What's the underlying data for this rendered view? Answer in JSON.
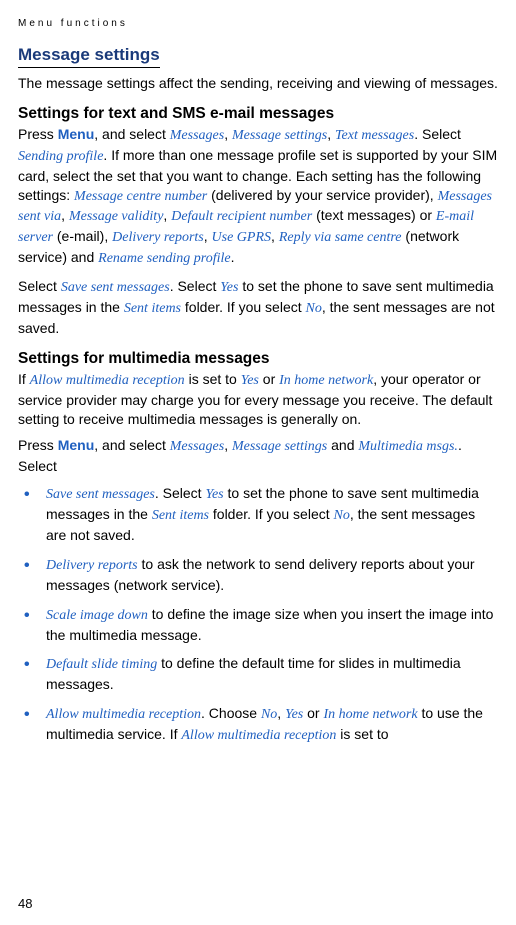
{
  "header_label": "Menu functions",
  "page_number": "48",
  "title": "Message settings",
  "intro": "The message settings affect the sending, receiving and viewing of messages.",
  "sms": {
    "heading": "Settings for text and SMS e-mail messages",
    "p1_1": "Press ",
    "p1_menu": "Menu",
    "p1_2": ", and select ",
    "p1_messages": "Messages",
    "p1_sep1": ", ",
    "p1_msg_settings": "Message settings",
    "p1_sep2": ", ",
    "p1_text_messages": "Text messages",
    "p1_3": ". Select ",
    "p1_sending_profile": "Sending profile",
    "p1_4": ". If more than one message profile set is supported by your SIM card, select the set that you want to change. Each setting has the following settings: ",
    "p1_centre": "Message centre number",
    "p1_5": " (delivered by your service provider), ",
    "p1_sentvia": "Messages sent via",
    "p1_sep3": ", ",
    "p1_validity": "Message validity",
    "p1_sep4": ", ",
    "p1_defrecip": "Default recipient number",
    "p1_6": " (text messages) or ",
    "p1_emailserver": "E-mail server",
    "p1_7": " (e-mail), ",
    "p1_delivery": "Delivery reports",
    "p1_sep5": ", ",
    "p1_gprs": "Use GPRS",
    "p1_sep6": ", ",
    "p1_replyvia": "Reply via same centre",
    "p1_8": " (network service) and ",
    "p1_rename": "Rename sending profile",
    "p1_9": ".",
    "p2_1": "Select ",
    "p2_save": "Save sent messages",
    "p2_2": ". Select ",
    "p2_yes": "Yes",
    "p2_3": " to set the phone to save sent multimedia messages in the ",
    "p2_sent": "Sent items",
    "p2_4": " folder. If you select ",
    "p2_no": "No",
    "p2_5": ", the sent messages are not saved."
  },
  "mms": {
    "heading": "Settings for multimedia messages",
    "p1_1": "If ",
    "p1_allow": "Allow multimedia reception",
    "p1_2": " is set to ",
    "p1_yes": "Yes",
    "p1_3": " or ",
    "p1_home": "In home network",
    "p1_4": ", your operator or service provider may charge you for every message you receive. The default setting to receive multimedia messages is generally on.",
    "p2_1": "Press ",
    "p2_menu": "Menu",
    "p2_2": ", and select ",
    "p2_messages": "Messages",
    "p2_sep1": ", ",
    "p2_msg_settings": "Message settings",
    "p2_3": " and ",
    "p2_mms": "Multimedia msgs.",
    "p2_4": ". Select",
    "bullets": {
      "b1_term": "Save sent messages",
      "b1_1": ". Select ",
      "b1_yes": "Yes",
      "b1_2": " to set the phone to save sent multimedia messages in the ",
      "b1_sent": "Sent items",
      "b1_3": " folder. If you select ",
      "b1_no": "No",
      "b1_4": ", the sent messages are not saved.",
      "b2_term": "Delivery reports",
      "b2_1": " to ask the network to send delivery reports about your messages (network service).",
      "b3_term": "Scale image down",
      "b3_1": " to define the image size when you insert the image into the multimedia message.",
      "b4_term": "Default slide timing",
      "b4_1": " to define the default time for slides in multimedia messages.",
      "b5_term": "Allow multimedia reception",
      "b5_1": ". Choose ",
      "b5_no": "No",
      "b5_sep1": ", ",
      "b5_yes": "Yes",
      "b5_2": " or ",
      "b5_home": "In home network",
      "b5_3": " to use the multimedia service. If ",
      "b5_allow2": "Allow multimedia reception",
      "b5_4": " is set to"
    }
  }
}
